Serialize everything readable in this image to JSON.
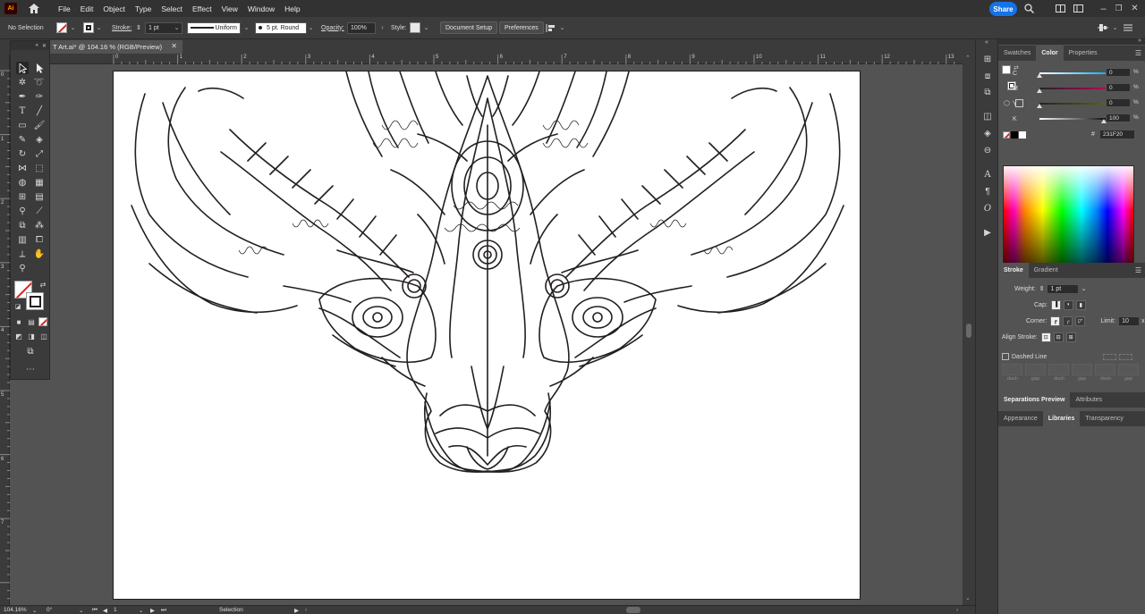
{
  "menubar": {
    "app_logo": "Ai",
    "items": [
      "File",
      "Edit",
      "Object",
      "Type",
      "Select",
      "Effect",
      "View",
      "Window",
      "Help"
    ],
    "share_label": "Share",
    "icons": [
      "home-icon",
      "search-icon",
      "arrange-documents-icon",
      "workspace-switcher-icon"
    ]
  },
  "controlbar": {
    "selection": "No Selection",
    "stroke_label": "Stroke:",
    "stroke_weight": "1 pt",
    "variable_width": "Uniform",
    "brush": "5 pt. Round",
    "opacity_label": "Opacity:",
    "opacity_value": "100%",
    "style_label": "Style:",
    "document_setup": "Document Setup",
    "preferences": "Preferences"
  },
  "document_tab": {
    "title": "T Art.ai* @ 104.16 % (RGB/Preview)"
  },
  "ruler": {
    "h_labels": [
      "0",
      "1",
      "2",
      "3",
      "4",
      "5",
      "6",
      "7",
      "8",
      "9",
      "10",
      "11",
      "12",
      "13"
    ],
    "v_labels": [
      "0",
      "1",
      "2",
      "3",
      "4",
      "5",
      "6",
      "7"
    ]
  },
  "color_panel": {
    "tabs": [
      "Swatches",
      "Color",
      "Properties"
    ],
    "active_tab": "Color",
    "channels": [
      {
        "name": "C",
        "value": "0",
        "unit": "%",
        "fraction": 0.0
      },
      {
        "name": "M",
        "value": "0",
        "unit": "%",
        "fraction": 0.0
      },
      {
        "name": "Y",
        "value": "0",
        "unit": "%",
        "fraction": 0.0
      },
      {
        "name": "K",
        "value": "100",
        "unit": "%",
        "fraction": 1.0
      }
    ],
    "hex_label": "#",
    "hex_value": "231F20"
  },
  "stroke_panel": {
    "tabs": [
      "Stroke",
      "Gradient"
    ],
    "weight_label": "Weight:",
    "weight_value": "1 pt",
    "cap_label": "Cap:",
    "corner_label": "Corner:",
    "limit_label": "Limit:",
    "limit_value": "10",
    "limit_unit": "x",
    "align_label": "Align Stroke:",
    "dashed_line_label": "Dashed Line",
    "dash_labels": [
      "dash",
      "gap",
      "dash",
      "gap",
      "dash",
      "gap"
    ]
  },
  "lower_tabs": {
    "row1": [
      "Separations Preview",
      "Attributes"
    ],
    "row2": [
      "Appearance",
      "Libraries",
      "Transparency"
    ],
    "active_row2": "Libraries"
  },
  "statusbar": {
    "zoom": "104.16%",
    "rotation": "0°",
    "artboard_number": "1",
    "tool_name": "Selection"
  },
  "colors": {
    "app_bg": "#535353",
    "panel_bg": "#3b3b3b",
    "share_blue": "#1473e6",
    "stroke_color": "#231F20",
    "none_red": "#e02020"
  }
}
